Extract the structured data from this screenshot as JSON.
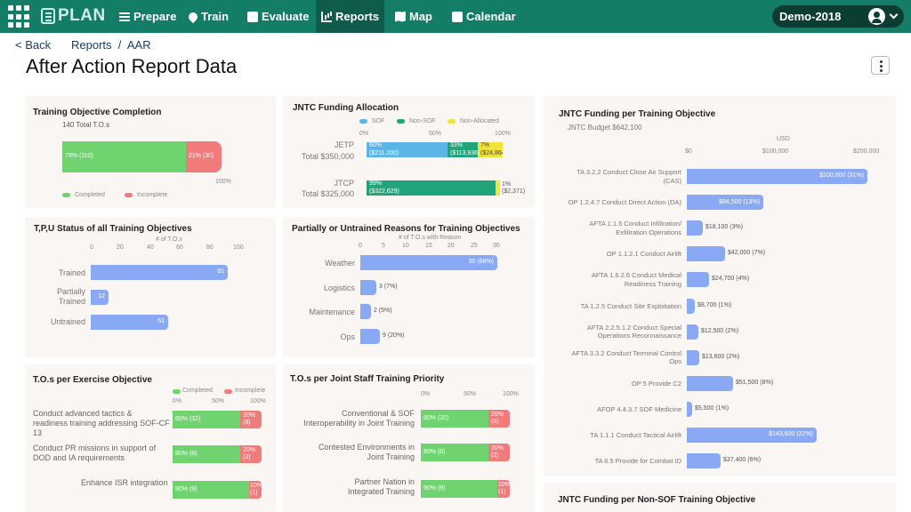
{
  "nav": {
    "logo": "PLAN",
    "items": [
      "Prepare",
      "Train",
      "Evaluate",
      "Reports",
      "Map",
      "Calendar"
    ],
    "active": "Reports",
    "profile": "Demo-2018"
  },
  "header": {
    "back": "< Back",
    "breadcrumb": "Reports  /  AAR",
    "title": "After Action Report Data"
  },
  "toc": {
    "title": "Training Objective Completion",
    "subtitle": "140 Total T.O.s",
    "completed_label": "79% (110)",
    "incomplete_label": "21% (30)",
    "axis_end": "100%",
    "legend": [
      "Completed",
      "Incomplete"
    ]
  },
  "jntc_alloc": {
    "title": "JNTC Funding Allocation",
    "legend": [
      "SOF",
      "Non-SOF",
      "Non-Allocated"
    ],
    "ticks": [
      "0%",
      "50%",
      "100%"
    ],
    "rows": [
      {
        "name": "JETP",
        "total": "Total $350,000",
        "sof": "60%\n($211,200)",
        "nonsof": "33%\n($113,936)",
        "na": "7%\n($24,864)"
      },
      {
        "name": "JTCP",
        "total": "Total $325,000",
        "sof": "99%\n($322,629)",
        "nonsof": "",
        "na": "1%\n($2,371)"
      }
    ]
  },
  "tpu": {
    "title": "T,P,U Status of all Training Objectives",
    "axis_title": "# of T.O.s",
    "ticks": [
      "0",
      "20",
      "40",
      "60",
      "80",
      "100"
    ],
    "rows": [
      {
        "label": "Trained",
        "value": "91"
      },
      {
        "label": "Partially\nTrained",
        "value": "12"
      },
      {
        "label": "Untrained",
        "value": "51"
      }
    ]
  },
  "reasons": {
    "title": "Partially or Untrained Reasons for Training Objectives",
    "axis_title": "# of T.O.s with Reason",
    "ticks": [
      "0",
      "5",
      "10",
      "15",
      "20",
      "25",
      "30"
    ],
    "rows": [
      {
        "label": "Weather",
        "value": "30 (68%)"
      },
      {
        "label": "Logistics",
        "value": "3 (7%)"
      },
      {
        "label": "Maintenance",
        "value": "2 (5%)"
      },
      {
        "label": "Ops",
        "value": "9 (20%)"
      }
    ]
  },
  "exercise_obj": {
    "title": "T.O.s per Exercise Objective",
    "legend": [
      "Completed",
      "Incomplete"
    ],
    "ticks": [
      "0%",
      "50%",
      "100%"
    ],
    "rows": [
      {
        "label": "Conduct advanced tactics &\nreadiness training addressing SOF-CF\n13",
        "completed": "80% (32)",
        "incomplete": "20%\n(8)"
      },
      {
        "label": "Conduct PR missions in support of\nDOD and IA requirements",
        "completed": "80% (8)",
        "incomplete": "20%\n(2)"
      },
      {
        "label": "Enhance ISR integration",
        "completed": "90% (9)",
        "incomplete": "10%\n(1)"
      }
    ]
  },
  "joint_staff": {
    "title": "T.O.s per Joint Staff Training Priority",
    "ticks": [
      "0%",
      "50%",
      "100%"
    ],
    "rows": [
      {
        "label": "Conventional & SOF\nInteroperability in Joint Training",
        "completed": "80% (32)",
        "incomplete": "20%\n(8)"
      },
      {
        "label": "Contested Environments in\nJoint Training",
        "completed": "80% (8)",
        "incomplete": "20%\n(2)"
      },
      {
        "label": "Partner Nation in\nIntegrated Training",
        "completed": "90% (9)",
        "incomplete": "10%\n(1)"
      }
    ]
  },
  "funding_to": {
    "title": "JNTC Funding per Training Objective",
    "subtitle": "JNTC Budget $642,100",
    "axis_title": "USD",
    "ticks": [
      "$0",
      "$100,000",
      "$200,000"
    ],
    "rows": [
      {
        "label": "TA 3.2.2 Conduct Close Air Support\n(CAS)",
        "value": "$200,000 (31%)"
      },
      {
        "label": "OP 1.2.4.7 Conduct Direct Action (DA)",
        "value": "$84,500 (13%)"
      },
      {
        "label": "AFTA 1.1.5 Conduct Infiltration/\nExfiltration Operations",
        "value": "$18,100 (3%)"
      },
      {
        "label": "OP 1.1.2.1 Conduct Airlift",
        "value": "$42,000 (7%)"
      },
      {
        "label": "AFTA 1.6.2.6 Conduct Medical\nReadiness Training",
        "value": "$24,700 (4%)"
      },
      {
        "label": "TA 1.2.5 Conduct Site Exploitation",
        "value": "$8,700 (1%)"
      },
      {
        "label": "AFTA 2.2.5.1.2 Conduct Special\nOperations Reconnaissance",
        "value": "$12,500 (2%)"
      },
      {
        "label": "AFTA 3.3.2 Conduct Terminal Control\nOps",
        "value": "$13,600 (2%)"
      },
      {
        "label": "OP 5 Provide C2",
        "value": "$51,500 (8%)"
      },
      {
        "label": "AFOP 4.4.3.7 SOF Medicine",
        "value": "$5,500 (1%)"
      },
      {
        "label": "TA 1.1.1 Conduct Tactical Airlift",
        "value": "$143,600 (22%)"
      },
      {
        "label": "TA 6.5 Provide for Combat ID",
        "value": "$37,400 (6%)"
      }
    ]
  },
  "funding_nonsof": {
    "title": "JNTC Funding per Non-SOF Training Objective"
  },
  "colors": {
    "nav": "#147d68",
    "completed": "#6fd46f",
    "incomplete": "#ef7b7b",
    "bar": "#8aa9f5",
    "sof": "#5bb5e6",
    "nonsof": "#22a37a",
    "nonallocated": "#f3e23b"
  },
  "chart_data": [
    {
      "type": "bar",
      "title": "Training Objective Completion",
      "categories": [
        "Completed",
        "Incomplete"
      ],
      "values": [
        110,
        30
      ],
      "percent": [
        79,
        21
      ]
    },
    {
      "type": "bar",
      "title": "JNTC Funding Allocation",
      "categories": [
        "JETP",
        "JTCP"
      ],
      "series": [
        {
          "name": "SOF",
          "values": [
            211200,
            322629
          ]
        },
        {
          "name": "Non-SOF",
          "values": [
            113936,
            0
          ]
        },
        {
          "name": "Non-Allocated",
          "values": [
            24864,
            2371
          ]
        }
      ]
    },
    {
      "type": "bar",
      "title": "T,P,U Status of all Training Objectives",
      "categories": [
        "Trained",
        "Partially Trained",
        "Untrained"
      ],
      "values": [
        91,
        12,
        51
      ],
      "xlim": [
        0,
        100
      ]
    },
    {
      "type": "bar",
      "title": "Partially or Untrained Reasons for Training Objectives",
      "categories": [
        "Weather",
        "Logistics",
        "Maintenance",
        "Ops"
      ],
      "values": [
        30,
        3,
        2,
        9
      ],
      "xlim": [
        0,
        30
      ]
    },
    {
      "type": "bar",
      "title": "JNTC Funding per Training Objective",
      "values": [
        200000,
        84500,
        18100,
        42000,
        24700,
        8700,
        12500,
        13600,
        51500,
        5500,
        143600,
        37400
      ],
      "xlim": [
        0,
        200000
      ]
    }
  ]
}
